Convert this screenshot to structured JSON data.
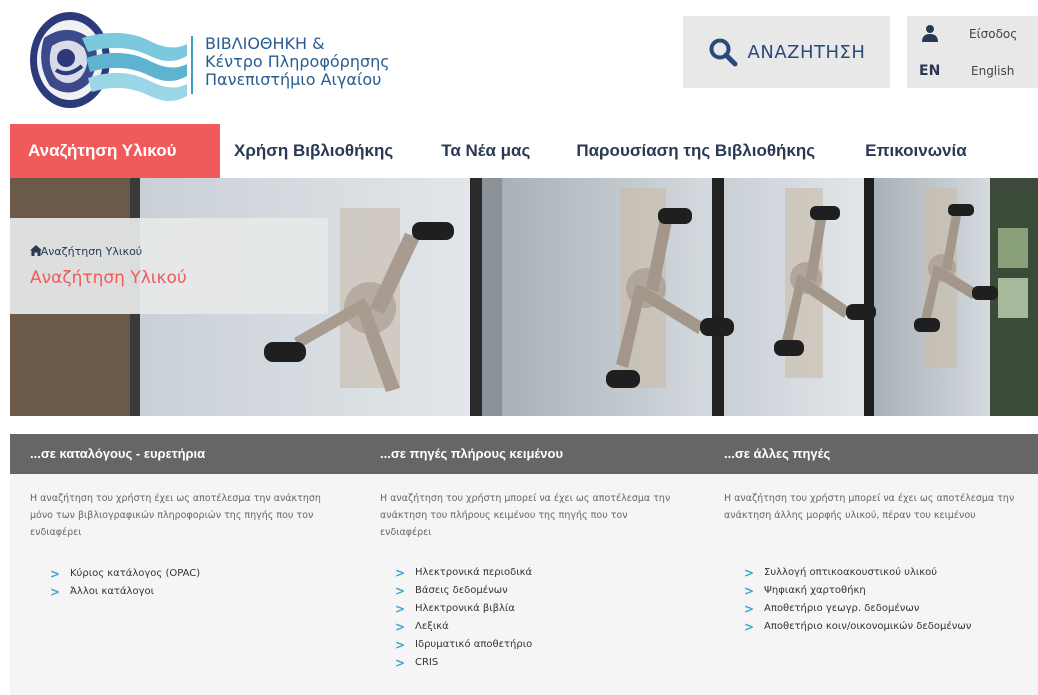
{
  "header": {
    "logo_lines": [
      "ΒΙΒΛΙΟΘΗΚΗ &",
      "Κέντρο Πληροφόρησης",
      "Πανεπιστήμιο Αιγαίου"
    ],
    "search_label": "ΑΝΑΖΗΤΗΣΗ",
    "account": {
      "login_label": "Είσοδος",
      "lang_code": "EN",
      "lang_label": "English"
    }
  },
  "nav": {
    "items": [
      {
        "label": "Αναζήτηση Υλικού",
        "active": true
      },
      {
        "label": "Χρήση Βιβλιοθήκης"
      },
      {
        "label": "Τα Νέα μας"
      },
      {
        "label": "Παρουσίαση της Βιβλιοθήκης"
      },
      {
        "label": "Επικοινωνία"
      }
    ]
  },
  "hero": {
    "breadcrumb": {
      "separator": "»",
      "current": "Αναζήτηση Υλικού"
    },
    "title": "Αναζήτηση Υλικού"
  },
  "columns": [
    {
      "heading": "...σε καταλόγους - ευρετήρια",
      "description": "Η αναζήτηση του χρήστη έχει ως αποτέλεσμα την ανάκτηση μόνο των βιβλιογραφικών πληροφοριών της πηγής που τον ενδιαφέρει",
      "links": [
        "Κύριος κατάλογος (OPAC)",
        "Άλλοι κατάλογοι"
      ]
    },
    {
      "heading": "...σε πηγές πλήρους κειμένου",
      "description": "Η αναζήτηση του χρήστη μπορεί να έχει ως αποτέλεσμα την ανάκτηση του πλήρους κειμένου της πηγής που τον ενδιαφέρει",
      "links": [
        "Ηλεκτρονικά περιοδικά",
        "Βάσεις δεδομένων",
        "Ηλεκτρονικά βιβλία",
        "Λεξικά",
        "Ιδρυματικό αποθετήριο",
        "CRIS"
      ]
    },
    {
      "heading": "...σε άλλες πηγές",
      "description": "Η αναζήτηση του χρήστη μπορεί να έχει ως αποτέλεσμα την ανάκτηση άλλης μορφής υλικού, πέραν του κειμένου",
      "links": [
        "Συλλογή οπτικοακουστικού υλικού",
        "Ψηφιακή χαρτοθήκη",
        "Αποθετήριο γεωγρ. δεδομένων",
        "Αποθετήριο κοιν/οικονομικών δεδομένων"
      ]
    }
  ],
  "colors": {
    "accent": "#f05a5a",
    "navy": "#2a3a55",
    "column_header_bg": "#666666",
    "link_chevron": "#3ba6c9"
  },
  "icons": [
    "university-logo",
    "search-icon",
    "user-icon",
    "home-icon",
    "chevron-right-icon"
  ]
}
